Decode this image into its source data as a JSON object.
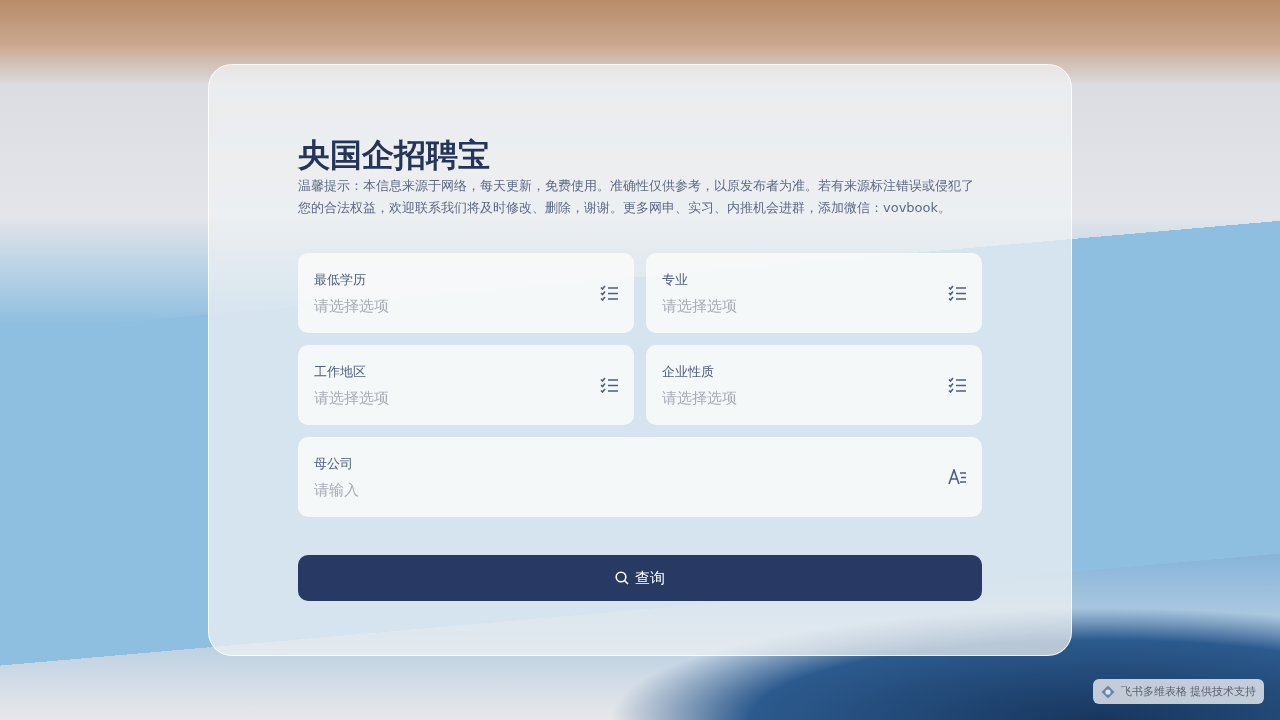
{
  "form": {
    "title": "央国企招聘宝",
    "notice": "温馨提示：本信息来源于网络，每天更新，免费使用。准确性仅供参考，以原发布者为准。若有来源标注错误或侵犯了您的合法权益，欢迎联系我们将及时修改、删除，谢谢。更多网申、实习、内推机会进群，添加微信：vovbook。",
    "fields": [
      {
        "kind": "select",
        "label": "最低学历",
        "placeholder": "请选择选项"
      },
      {
        "kind": "select",
        "label": "专业",
        "placeholder": "请选择选项"
      },
      {
        "kind": "select",
        "label": "工作地区",
        "placeholder": "请选择选项"
      },
      {
        "kind": "select",
        "label": "企业性质",
        "placeholder": "请选择选项"
      },
      {
        "kind": "text",
        "label": "母公司",
        "placeholder": "请输入"
      }
    ],
    "submit": "查询"
  },
  "badge": {
    "brand": "飞书多维表格",
    "text": "提供技术支持"
  }
}
